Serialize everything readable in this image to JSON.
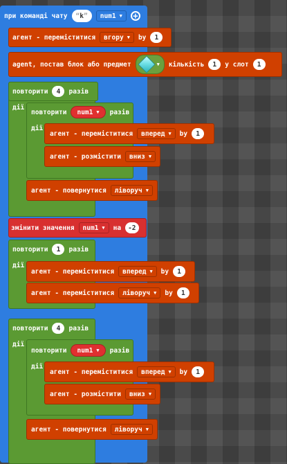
{
  "event": {
    "label": "при команді чату",
    "quote_open": "“",
    "quote_close": "”",
    "command": "k",
    "var": "num1"
  },
  "move_up": {
    "label": "агент - переміститися",
    "dir": "вгору",
    "by": "by",
    "n": "1"
  },
  "place": {
    "label": "agent, постав блок або предмет",
    "count_label": "кількість",
    "count": "1",
    "slot_label": "у слот",
    "slot": "1"
  },
  "repeat1": {
    "label": "повторити",
    "n": "4",
    "times": "разів",
    "do": "дії"
  },
  "inner1": {
    "label": "повторити",
    "var": "num1",
    "times": "разів",
    "do": "дії"
  },
  "move_fwd": {
    "label": "агент - переміститися",
    "dir": "вперед",
    "by": "by",
    "n": "1"
  },
  "place_down": {
    "label": "агент - розмістити",
    "dir": "вниз"
  },
  "turn": {
    "label": "агент - повернутися",
    "dir": "ліворуч"
  },
  "change": {
    "label": "змінити значення",
    "var": "num1",
    "on": "на",
    "n": "-2"
  },
  "repeat2": {
    "label": "повторити",
    "n": "1",
    "times": "разів",
    "do": "дії"
  },
  "move_fwd2": {
    "label": "агент - переміститися",
    "dir": "вперед",
    "by": "by",
    "n": "1"
  },
  "move_left": {
    "label": "агент - переміститися",
    "dir": "ліворуч",
    "by": "by",
    "n": "1"
  },
  "repeat3": {
    "label": "повторити",
    "n": "4",
    "times": "разів",
    "do": "дії"
  },
  "inner3": {
    "label": "повторити",
    "var": "num1",
    "times": "разів",
    "do": "дії"
  },
  "move_fwd3": {
    "label": "агент - переміститися",
    "dir": "вперед",
    "by": "by",
    "n": "1"
  },
  "place_down3": {
    "label": "агент - розмістити",
    "dir": "вниз"
  },
  "turn3": {
    "label": "агент - повернутися",
    "dir": "ліворуч"
  }
}
